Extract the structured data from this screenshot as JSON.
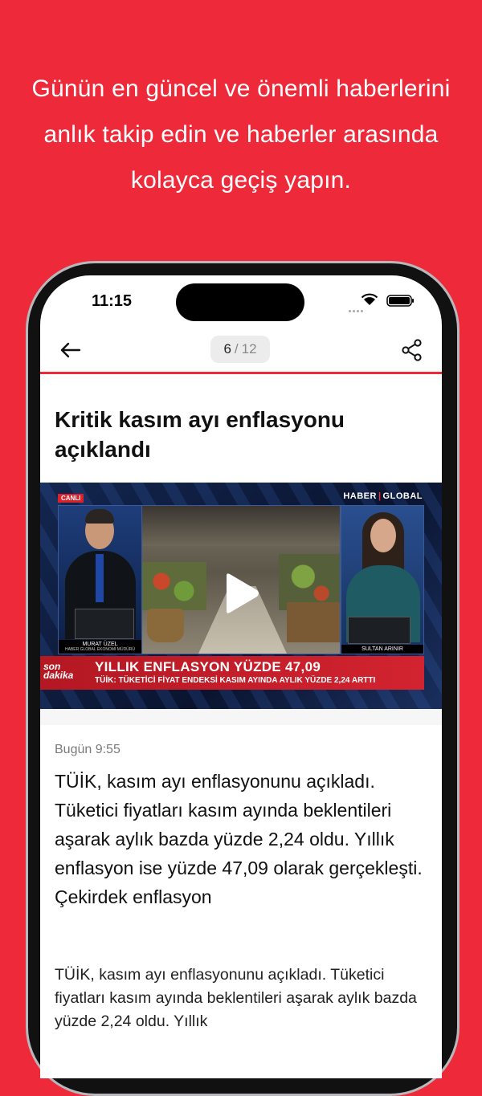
{
  "promo": {
    "line1": "Günün en güncel ve önemli haberlerini",
    "line2": "anlık takip edin ve haberler arasında",
    "line3": "kolayca geçiş yapın."
  },
  "status": {
    "time": "11:15"
  },
  "nav": {
    "current_page": "6",
    "separator": "/",
    "total_pages": "12"
  },
  "article": {
    "title": "Kritik kasım ayı enflasyonu açıklandı",
    "timestamp": "Bugün 9:55",
    "summary": "TÜİK, kasım ayı enflasyonunu açıkladı. Tüketici fiyatları kasım ayında beklentileri aşarak aylık bazda yüzde 2,24 oldu. Yıllık enflasyon ise yüzde 47,09 olarak gerçekleşti. Çekirdek enflasyon",
    "body": "TÜİK, kasım ayı enflasyonunu açıkladı. Tüketici fiyatları kasım ayında beklentileri aşarak aylık bazda yüzde 2,24 oldu. Yıllık"
  },
  "video": {
    "live_badge": "CANLI",
    "channel_part1": "HABER",
    "channel_sep": "|",
    "channel_part2": "GLOBAL",
    "anchor_left_name": "MURAT ÜZEL",
    "anchor_left_title": "HABER GLOBAL EKONOMİ MÜDÜRÜ",
    "anchor_right_name": "SULTAN ARINIR",
    "ticker_logo_1": "son",
    "ticker_logo_2": "dakika",
    "ticker_headline": "YILLIK ENFLASYON YÜZDE 47,09",
    "ticker_sub": "TÜİK: TÜKETİCİ FİYAT ENDEKSİ KASIM AYINDA AYLIK YÜZDE 2,24 ARTTI"
  },
  "colors": {
    "brand": "#ee2a3a",
    "ticker": "#c81e2a"
  },
  "icons": {
    "back": "arrow-left-icon",
    "share": "share-icon",
    "play": "play-icon"
  }
}
